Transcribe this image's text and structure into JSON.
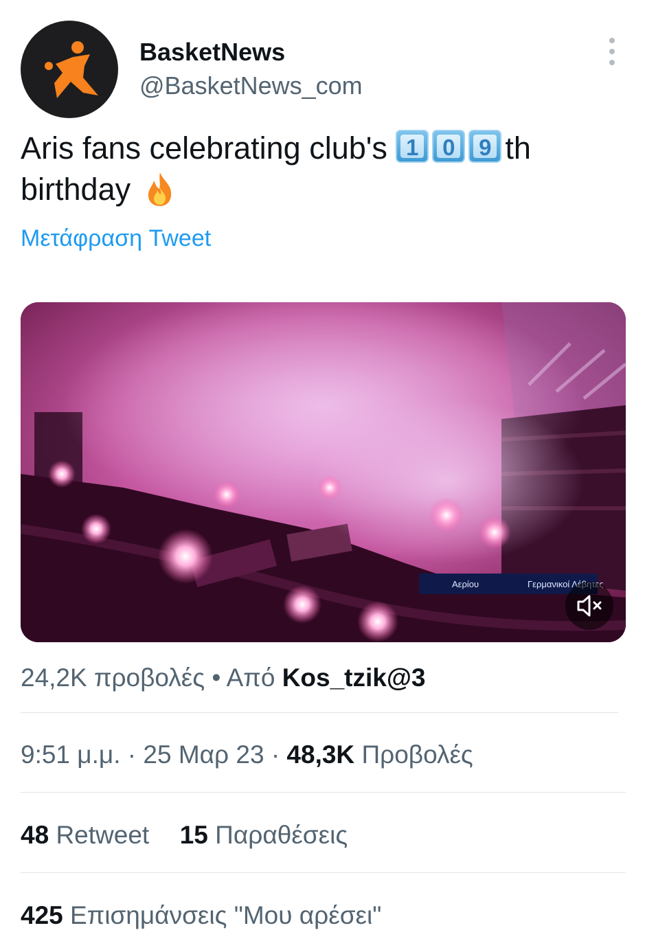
{
  "author": {
    "display_name": "BasketNews",
    "handle": "@BasketNews_com",
    "avatar_icon": "orange-figure-logo",
    "avatar_bg": "#1d1d1f",
    "logo_color": "#f7821e"
  },
  "tweet": {
    "text_before": "Aris fans celebrating club's ",
    "keycaps": [
      "1",
      "0",
      "9"
    ],
    "text_after_keycaps": "th",
    "text_line2": "birthday",
    "trailing_emoji": "fire-emoji",
    "translate_label": "Μετάφραση Tweet"
  },
  "media": {
    "type": "video",
    "mute_icon": "speaker-muted-icon",
    "banner_texts": [
      "Αερίου",
      "Γερμανικοί Λέβητες"
    ]
  },
  "video_stats": {
    "views": "24,2K προβολές",
    "separator": "•",
    "from_label": "Από",
    "from_user": "Kos_tzik@3"
  },
  "meta": {
    "time": "9:51 μ.μ.",
    "dot1": "·",
    "date": "25 Μαρ 23",
    "dot2": "·",
    "views_count": "48,3K",
    "views_label": "Προβολές"
  },
  "engagement": {
    "retweets_count": "48",
    "retweets_label": "Retweet",
    "quotes_count": "15",
    "quotes_label": "Παραθέσεις",
    "likes_count": "425",
    "likes_label": "Επισημάνσεις \"Μου αρέσει\""
  },
  "colors": {
    "link": "#1d9bf0",
    "secondary_text": "#536471",
    "primary_text": "#0f1419"
  }
}
